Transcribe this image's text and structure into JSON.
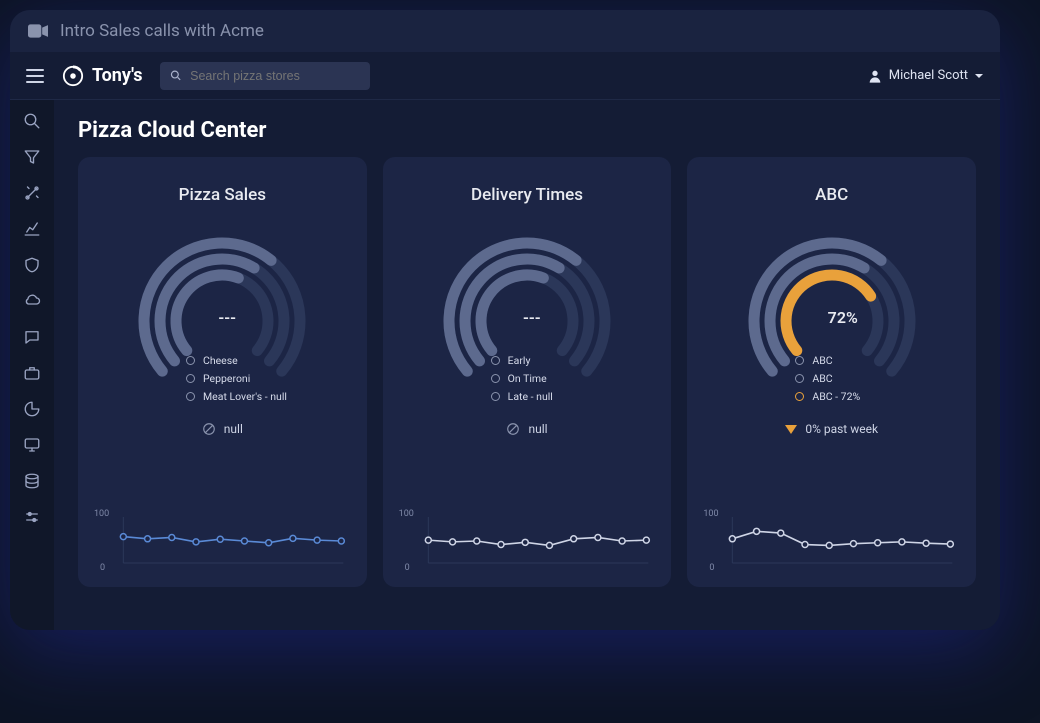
{
  "titlebar": {
    "title": "Intro Sales calls with Acme"
  },
  "topbar": {
    "brand": "Tony's",
    "search_placeholder": "Search pizza stores",
    "user_name": "Michael Scott"
  },
  "page": {
    "title": "Pizza Cloud Center"
  },
  "sidebar_icons": [
    "search-icon",
    "filter-icon",
    "tools-icon",
    "line-chart-icon",
    "shield-icon",
    "cloud-icon",
    "comment-icon",
    "briefcase-icon",
    "pie-chart-icon",
    "monitor-icon",
    "database-icon",
    "sliders-icon"
  ],
  "cards": [
    {
      "title": "Pizza Sales",
      "center_value": "---",
      "legend": [
        {
          "label": "Cheese"
        },
        {
          "label": "Pepperoni"
        },
        {
          "label": "Meat Lover's - null"
        }
      ],
      "footnote": "null",
      "footnote_kind": "null",
      "accent": "#5a8ad6"
    },
    {
      "title": "Delivery Times",
      "center_value": "---",
      "legend": [
        {
          "label": "Early"
        },
        {
          "label": "On Time"
        },
        {
          "label": "Late - null"
        }
      ],
      "footnote": "null",
      "footnote_kind": "null",
      "accent": "#cfd5e6"
    },
    {
      "title": "ABC",
      "center_value": "72%",
      "legend": [
        {
          "label": "ABC"
        },
        {
          "label": "ABC"
        },
        {
          "label": "ABC - 72%",
          "accent": true
        }
      ],
      "footnote": "0% past week",
      "footnote_kind": "trend-down",
      "accent": "#e9a13b"
    }
  ],
  "chart_data": [
    {
      "type": "line",
      "title": "Pizza Sales sparkline",
      "ylim": [
        0,
        100
      ],
      "y_ticks": [
        "100",
        "0"
      ],
      "values": [
        60,
        55,
        58,
        48,
        54,
        50,
        46,
        56,
        52,
        50
      ]
    },
    {
      "type": "line",
      "title": "Delivery Times sparkline",
      "ylim": [
        0,
        100
      ],
      "y_ticks": [
        "100",
        "0"
      ],
      "values": [
        52,
        48,
        50,
        42,
        47,
        40,
        55,
        58,
        50,
        52
      ]
    },
    {
      "type": "line",
      "title": "ABC sparkline",
      "ylim": [
        0,
        100
      ],
      "y_ticks": [
        "100",
        "0"
      ],
      "values": [
        55,
        72,
        68,
        42,
        40,
        44,
        46,
        48,
        45,
        43
      ]
    }
  ],
  "donut_data": [
    {
      "type": "radial",
      "rings": [
        0.65,
        0.62,
        0.58
      ],
      "accent_ring": null
    },
    {
      "type": "radial",
      "rings": [
        0.65,
        0.62,
        0.58
      ],
      "accent_ring": null
    },
    {
      "type": "radial",
      "rings": [
        0.65,
        0.62,
        0.72
      ],
      "accent_ring": 2,
      "accent_color": "#e9a13b"
    }
  ]
}
